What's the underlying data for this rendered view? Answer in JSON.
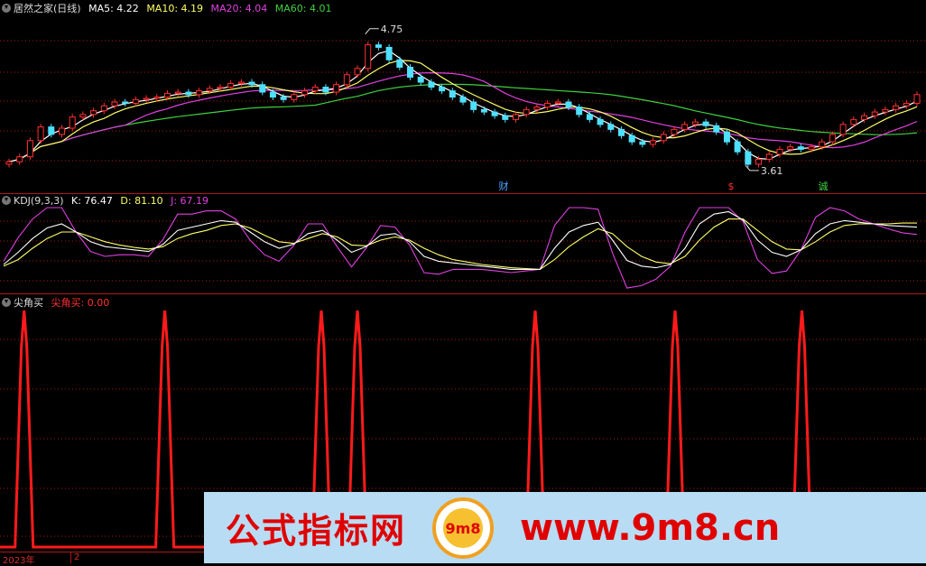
{
  "main": {
    "title": "居然之家(日线)",
    "ma": [
      {
        "label": "MA5: 4.22",
        "color": "#ffffff"
      },
      {
        "label": "MA10: 4.19",
        "color": "#ffff66"
      },
      {
        "label": "MA20: 4.04",
        "color": "#e040e0"
      },
      {
        "label": "MA60: 4.01",
        "color": "#40d040"
      }
    ],
    "high_marker": "4.75",
    "low_marker": "3.61",
    "event_labels": [
      {
        "text": "财",
        "color": "#4da3ff"
      },
      {
        "text": "$",
        "color": "#ff3030"
      },
      {
        "text": "诚",
        "color": "#40d040"
      }
    ]
  },
  "kdj": {
    "name": "KDJ(9,3,3)",
    "k": "K: 76.47",
    "d": "D: 81.10",
    "j": "J: 67.19"
  },
  "spike": {
    "name": "尖角买",
    "series_label": "尖角买: 0.00"
  },
  "time_axis": {
    "year": "2023年",
    "month": "2"
  },
  "watermark": {
    "title": "公式指标网",
    "url": "www.9m8.cn",
    "logo_text": "9m8"
  },
  "colors": {
    "up": "#ff3030",
    "down": "#4ee0ff",
    "grid": "#b01818",
    "spike": "#ff1a1a"
  },
  "chart_data": [
    {
      "type": "candlestick",
      "title": "居然之家(日线)",
      "ylim": [
        3.5,
        4.85
      ],
      "close": [
        3.68,
        3.72,
        3.85,
        3.96,
        3.9,
        3.95,
        4.04,
        4.06,
        4.09,
        4.13,
        4.16,
        4.15,
        4.18,
        4.19,
        4.2,
        4.23,
        4.24,
        4.22,
        4.25,
        4.27,
        4.28,
        4.31,
        4.32,
        4.3,
        4.24,
        4.2,
        4.18,
        4.22,
        4.25,
        4.28,
        4.24,
        4.3,
        4.38,
        4.43,
        4.62,
        4.6,
        4.5,
        4.44,
        4.36,
        4.32,
        4.28,
        4.25,
        4.2,
        4.16,
        4.1,
        4.08,
        4.05,
        4.02,
        4.06,
        4.1,
        4.12,
        4.15,
        4.16,
        4.12,
        4.06,
        4.02,
        3.98,
        3.94,
        3.89,
        3.84,
        3.82,
        3.85,
        3.9,
        3.94,
        3.98,
        4.0,
        3.97,
        3.92,
        3.84,
        3.76,
        3.66,
        3.7,
        3.74,
        3.78,
        3.8,
        3.78,
        3.8,
        3.84,
        3.9,
        3.98,
        4.02,
        4.05,
        4.08,
        4.1,
        4.13,
        4.15,
        4.22
      ],
      "high_marker": 4.75,
      "low_marker": 3.61,
      "series": [
        {
          "name": "MA5",
          "last": 4.22
        },
        {
          "name": "MA10",
          "last": 4.19
        },
        {
          "name": "MA20",
          "last": 4.04
        },
        {
          "name": "MA60",
          "last": 4.01
        }
      ]
    },
    {
      "type": "line",
      "title": "KDJ(9,3,3)",
      "ylim": [
        0,
        100
      ],
      "series": [
        {
          "name": "K",
          "last": 76.47,
          "values": [
            30,
            45,
            62,
            75,
            80,
            70,
            58,
            52,
            50,
            48,
            46,
            55,
            72,
            76,
            80,
            84,
            82,
            70,
            58,
            50,
            55,
            68,
            72,
            60,
            45,
            52,
            66,
            68,
            58,
            40,
            34,
            32,
            30,
            28,
            26,
            24,
            24,
            24,
            50,
            70,
            78,
            82,
            60,
            35,
            28,
            26,
            30,
            50,
            80,
            92,
            95,
            85,
            60,
            45,
            40,
            48,
            68,
            80,
            84,
            82,
            80,
            78,
            77,
            76
          ]
        },
        {
          "name": "D",
          "last": 81.1,
          "values": [
            28,
            36,
            50,
            62,
            70,
            70,
            64,
            58,
            54,
            51,
            49,
            52,
            62,
            68,
            72,
            78,
            80,
            75,
            66,
            58,
            56,
            62,
            68,
            64,
            54,
            53,
            60,
            64,
            60,
            50,
            42,
            36,
            33,
            30,
            28,
            26,
            25,
            24,
            36,
            52,
            64,
            74,
            68,
            52,
            40,
            33,
            31,
            40,
            60,
            76,
            86,
            86,
            72,
            58,
            49,
            48,
            58,
            70,
            78,
            80,
            80,
            80,
            81,
            81
          ]
        },
        {
          "name": "J",
          "last": 67.19,
          "values": [
            34,
            63,
            86,
            100,
            100,
            70,
            46,
            40,
            42,
            42,
            40,
            61,
            92,
            92,
            96,
            96,
            86,
            60,
            42,
            34,
            53,
            80,
            80,
            52,
            27,
            50,
            78,
            76,
            54,
            20,
            18,
            24,
            24,
            24,
            22,
            20,
            22,
            24,
            78,
            100,
            100,
            98,
            44,
            1,
            4,
            12,
            28,
            70,
            100,
            100,
            100,
            83,
            36,
            19,
            22,
            48,
            88,
            100,
            96,
            86,
            80,
            74,
            69,
            67
          ]
        }
      ]
    },
    {
      "type": "line",
      "title": "尖角买",
      "ylim": [
        0,
        1
      ],
      "series": [
        {
          "name": "尖角买",
          "last": 0.0,
          "spikes_at_fraction": [
            0.026,
            0.178,
            0.347,
            0.386,
            0.578,
            0.729,
            0.866
          ]
        }
      ]
    }
  ]
}
